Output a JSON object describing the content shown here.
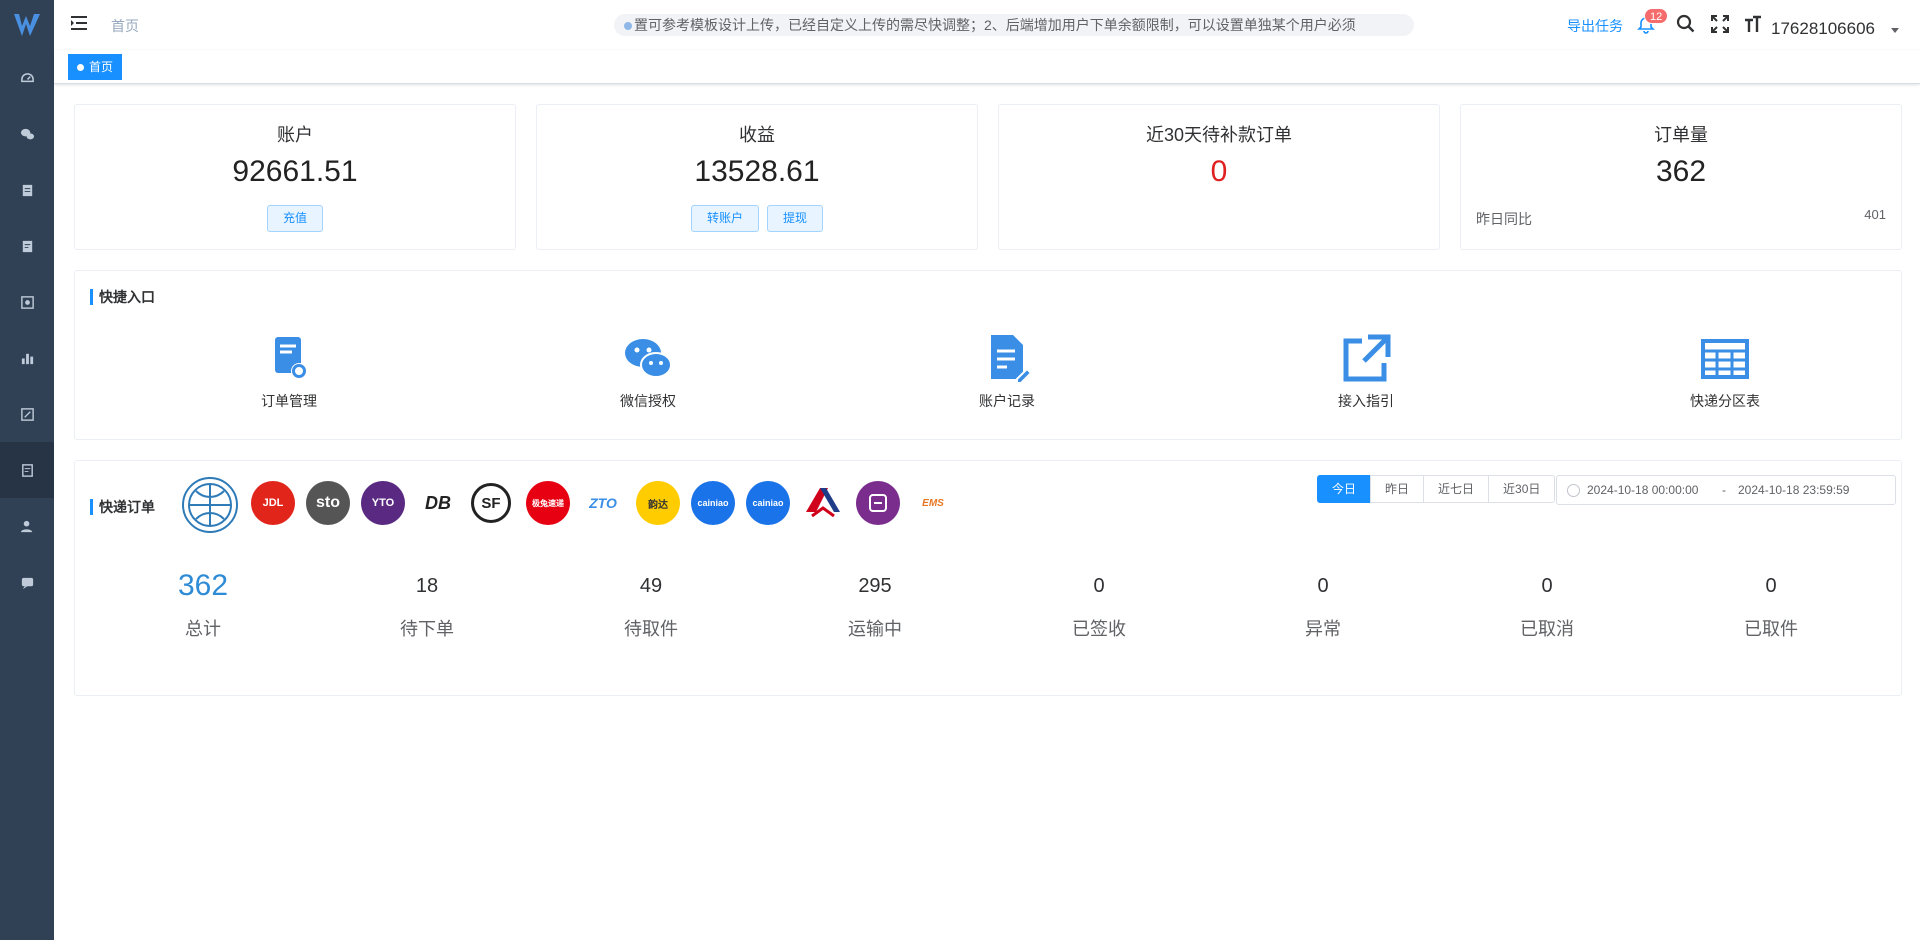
{
  "nav": {
    "breadcrumb": "首页",
    "marquee": "置可参考模板设计上传，已经自定义上传的需尽快调整；2、后端增加用户下单余额限制，可以设置单独某个用户必须",
    "export_label": "导出任务",
    "notification_count": "12",
    "username": "17628106606"
  },
  "tags": {
    "home": "首页"
  },
  "stats": [
    {
      "title": "账户",
      "value": "92661.51",
      "buttons": [
        "充值"
      ]
    },
    {
      "title": "收益",
      "value": "13528.61",
      "buttons": [
        "转账户",
        "提现"
      ]
    },
    {
      "title": "近30天待补款订单",
      "value": "0"
    },
    {
      "title": "订单量",
      "value": "362",
      "foot_label": "昨日同比",
      "foot_value": "401"
    }
  ],
  "quick": {
    "title": "快捷入口",
    "items": [
      {
        "label": "订单管理",
        "icon": "order-manage-icon"
      },
      {
        "label": "微信授权",
        "icon": "wechat-icon"
      },
      {
        "label": "账户记录",
        "icon": "account-record-icon"
      },
      {
        "label": "接入指引",
        "icon": "external-link-icon"
      },
      {
        "label": "快递分区表",
        "icon": "table-grid-icon"
      }
    ]
  },
  "orders": {
    "title": "快递订单",
    "carriers": [
      "JDL",
      "sto",
      "YTO",
      "DB",
      "SF",
      "极兔速递",
      "ZTO",
      "韵达",
      "cainiao",
      "cainiao",
      "",
      "",
      "EMS"
    ],
    "ranges": [
      "今日",
      "昨日",
      "近七日",
      "近30日"
    ],
    "date_start": "2024-10-18 00:00:00",
    "date_sep": "-",
    "date_end": "2024-10-18 23:59:59",
    "metrics": [
      {
        "value": "362",
        "label": "总计"
      },
      {
        "value": "18",
        "label": "待下单"
      },
      {
        "value": "49",
        "label": "待取件"
      },
      {
        "value": "295",
        "label": "运输中"
      },
      {
        "value": "0",
        "label": "已签收"
      },
      {
        "value": "0",
        "label": "异常"
      },
      {
        "value": "0",
        "label": "已取消"
      },
      {
        "value": "0",
        "label": "已取件"
      }
    ]
  },
  "colors": {
    "accent": "#1890ff",
    "sidebar": "#304156",
    "danger": "#e02020"
  }
}
